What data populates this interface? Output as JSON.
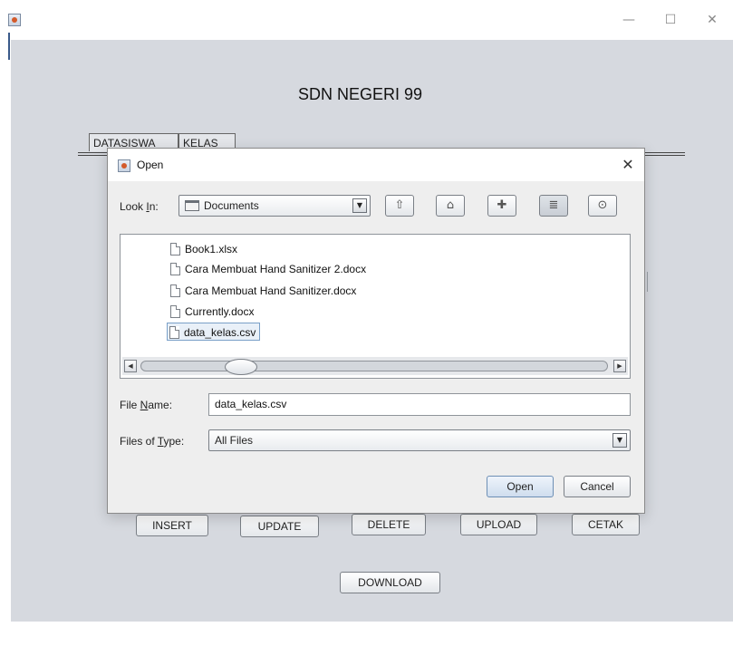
{
  "window": {
    "minimize": "—",
    "maximize": "☐",
    "close": "✕"
  },
  "app": {
    "title": "SDN NEGERI 99",
    "tabs": [
      {
        "label": "DATASISWA"
      },
      {
        "label": "KELAS"
      }
    ],
    "buttons": {
      "insert": "INSERT",
      "update": "UPDATE",
      "delete": "DELETE",
      "upload": "UPLOAD",
      "cetak": "CETAK",
      "download": "DOWNLOAD"
    }
  },
  "dialog": {
    "title": "Open",
    "close_glyph": "✕",
    "look_in_label_pre": "Look ",
    "look_in_label_key": "I",
    "look_in_label_post": "n:",
    "look_in_value": "Documents",
    "toolbar": {
      "up": "⇧",
      "home": "⌂",
      "new_folder": "✚",
      "list": "≣",
      "details": "⊙"
    },
    "files": [
      {
        "name": "Book1.xlsx",
        "selected": false
      },
      {
        "name": "Cara Membuat Hand Sanitizer 2.docx",
        "selected": false
      },
      {
        "name": "Cara Membuat Hand Sanitizer.docx",
        "selected": false
      },
      {
        "name": "Currently.docx",
        "selected": false
      },
      {
        "name": "data_kelas.csv",
        "selected": true
      }
    ],
    "file_name_label_pre": "File ",
    "file_name_label_key": "N",
    "file_name_label_post": "ame:",
    "file_name_value": "data_kelas.csv",
    "files_of_type_label_pre": "Files of ",
    "files_of_type_label_key": "T",
    "files_of_type_label_post": "ype:",
    "files_of_type_value": "All Files",
    "open_button": "Open",
    "cancel_button": "Cancel"
  },
  "colors": {
    "client_bg": "#d6d9df",
    "dialog_bg": "#eeeeee",
    "selection": "#e9f0f8"
  }
}
